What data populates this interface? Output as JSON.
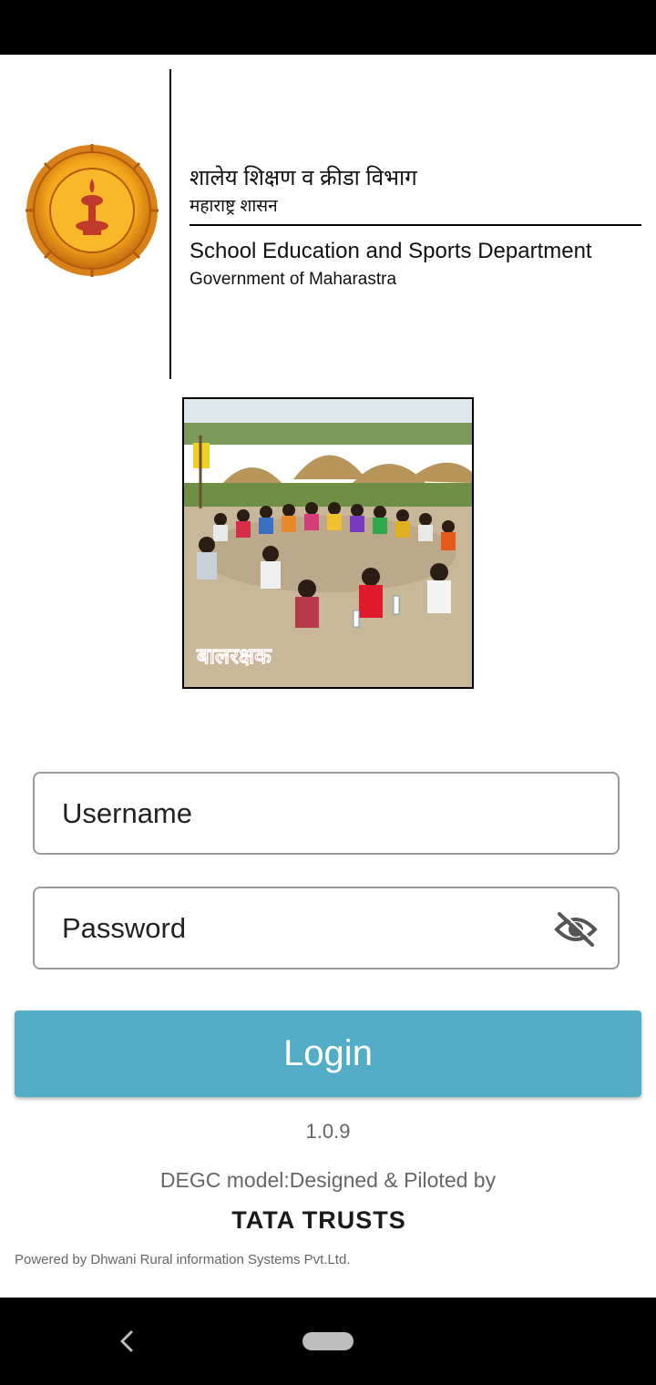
{
  "header": {
    "department_marathi": "शालेय शिक्षण व क्रीडा विभाग",
    "government_marathi": "महाराष्ट्र शासन",
    "department_english": "School Education and Sports Department",
    "government_english": "Government of Maharastra"
  },
  "banner": {
    "caption": "बालरक्षक"
  },
  "form": {
    "username_placeholder": "Username",
    "username_value": "",
    "password_placeholder": "Password",
    "password_value": "",
    "password_toggle_icon": "eye-off-icon",
    "login_label": "Login"
  },
  "footer": {
    "version": "1.0.9",
    "credit": "DEGC model:Designed & Piloted by",
    "partner": "TATA TRUSTS",
    "powered_by": "Powered by Dhwani Rural information Systems Pvt.Ltd."
  },
  "colors": {
    "login_button": "#53adc7",
    "field_border": "#9b9b9b",
    "emblem_gold": "#f2a51a",
    "banner_caption": "#d61f26"
  }
}
